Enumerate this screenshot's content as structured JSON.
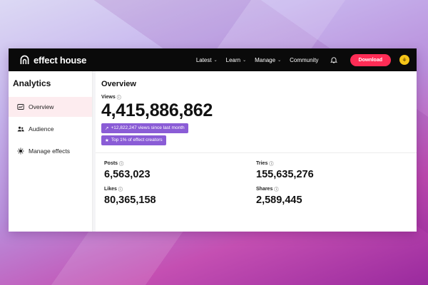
{
  "brand": {
    "name": "effect house"
  },
  "nav": {
    "items": [
      {
        "label": "Latest",
        "has_menu": true
      },
      {
        "label": "Learn",
        "has_menu": true
      },
      {
        "label": "Manage",
        "has_menu": true
      },
      {
        "label": "Community",
        "has_menu": false
      }
    ],
    "download_label": "Download",
    "avatar_icon": "avatar-icon"
  },
  "sidebar": {
    "title": "Analytics",
    "items": [
      {
        "label": "Overview",
        "icon": "chart-icon",
        "active": true
      },
      {
        "label": "Audience",
        "icon": "users-icon",
        "active": false
      },
      {
        "label": "Manage effects",
        "icon": "effects-icon",
        "active": false
      }
    ]
  },
  "overview": {
    "title": "Overview",
    "views_label": "Views",
    "views_value": "4,415,886,862",
    "badges": [
      {
        "icon": "trend-up-icon",
        "text": "+12,822,247 views since last month"
      },
      {
        "icon": "star-icon",
        "text": "Top 1% of effect creators"
      }
    ],
    "stats": [
      {
        "label": "Posts",
        "value": "6,563,023"
      },
      {
        "label": "Tries",
        "value": "155,635,276"
      },
      {
        "label": "Likes",
        "value": "80,365,158"
      },
      {
        "label": "Shares",
        "value": "2,589,445"
      }
    ]
  },
  "colors": {
    "topbar": "#0a0a0a",
    "download": "#fe2c55",
    "badge": "#8a5cd6",
    "active_bg": "#fdecef",
    "avatar": "#f5c518"
  }
}
